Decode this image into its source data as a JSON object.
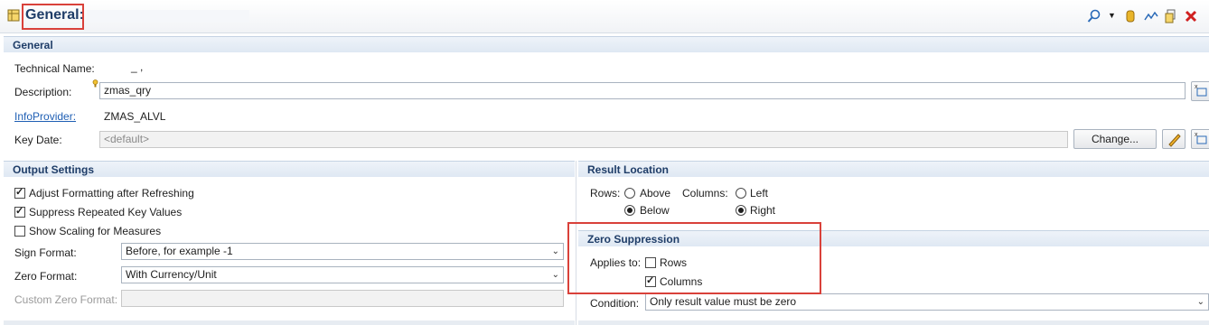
{
  "header": {
    "title": "General:"
  },
  "general": {
    "section_title": "General",
    "technical_name_label": "Technical Name:",
    "technical_name_value": "_ ,",
    "description_label": "Description:",
    "description_value": "zmas_qry",
    "infoprovider_label": "InfoProvider:",
    "infoprovider_value": "ZMAS_ALVL",
    "key_date_label": "Key Date:",
    "key_date_value": "<default>",
    "change_button": "Change..."
  },
  "output_settings": {
    "section_title": "Output Settings",
    "adjust_formatting": {
      "label": "Adjust Formatting after Refreshing",
      "checked": true
    },
    "suppress_repeated": {
      "label": "Suppress Repeated Key Values",
      "checked": true
    },
    "show_scaling": {
      "label": "Show Scaling for Measures",
      "checked": false
    },
    "sign_format_label": "Sign Format:",
    "sign_format_value": "Before, for example -1",
    "zero_format_label": "Zero Format:",
    "zero_format_value": "With Currency/Unit",
    "custom_zero_format_label": "Custom Zero Format:",
    "custom_zero_format_value": ""
  },
  "result_location": {
    "section_title": "Result Location",
    "rows_label": "Rows:",
    "rows_above": "Above",
    "rows_below": "Below",
    "rows_selected": "Below",
    "columns_label": "Columns:",
    "columns_left": "Left",
    "columns_right": "Right",
    "columns_selected": "Right"
  },
  "zero_suppression": {
    "section_title": "Zero Suppression",
    "applies_to_label": "Applies to:",
    "rows": {
      "label": "Rows",
      "checked": false
    },
    "columns": {
      "label": "Columns",
      "checked": true
    },
    "condition_label": "Condition:",
    "condition_value": "Only result value must be zero"
  },
  "colors": {
    "accent": "#1f3d68",
    "highlight": "#d9413a",
    "link": "#1f5fb4"
  },
  "toolbar_icons": [
    "search-dropdown-icon",
    "cylinder-icon",
    "wave-icon",
    "copy-icon",
    "delete-icon",
    "refresh-icon"
  ]
}
